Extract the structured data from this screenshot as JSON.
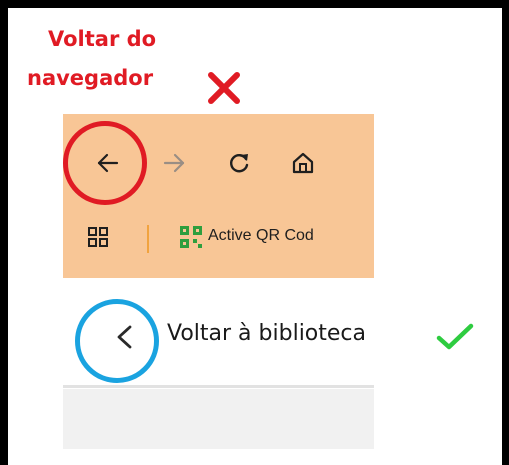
{
  "annotation": {
    "browser_back_title_line1": "Voltar do",
    "browser_back_title_line2": "navegador",
    "wrong_mark": "x-mark-icon",
    "right_mark": "check-mark-icon",
    "highlight_wrong_color": "#e01b24",
    "highlight_right_color": "#1aa3e0",
    "check_color": "#2ecc40"
  },
  "browser": {
    "background": "#f8c696",
    "toolbar_icons": [
      "back-arrow-icon",
      "forward-arrow-icon",
      "reload-icon",
      "home-icon"
    ],
    "bookmarks_bar": {
      "apps_icon": "apps-grid-icon",
      "bookmark_icon": "qr-code-icon",
      "bookmark_label": "Active QR Cod"
    }
  },
  "library": {
    "back_icon": "chevron-left-icon",
    "back_label": "Voltar à biblioteca"
  }
}
